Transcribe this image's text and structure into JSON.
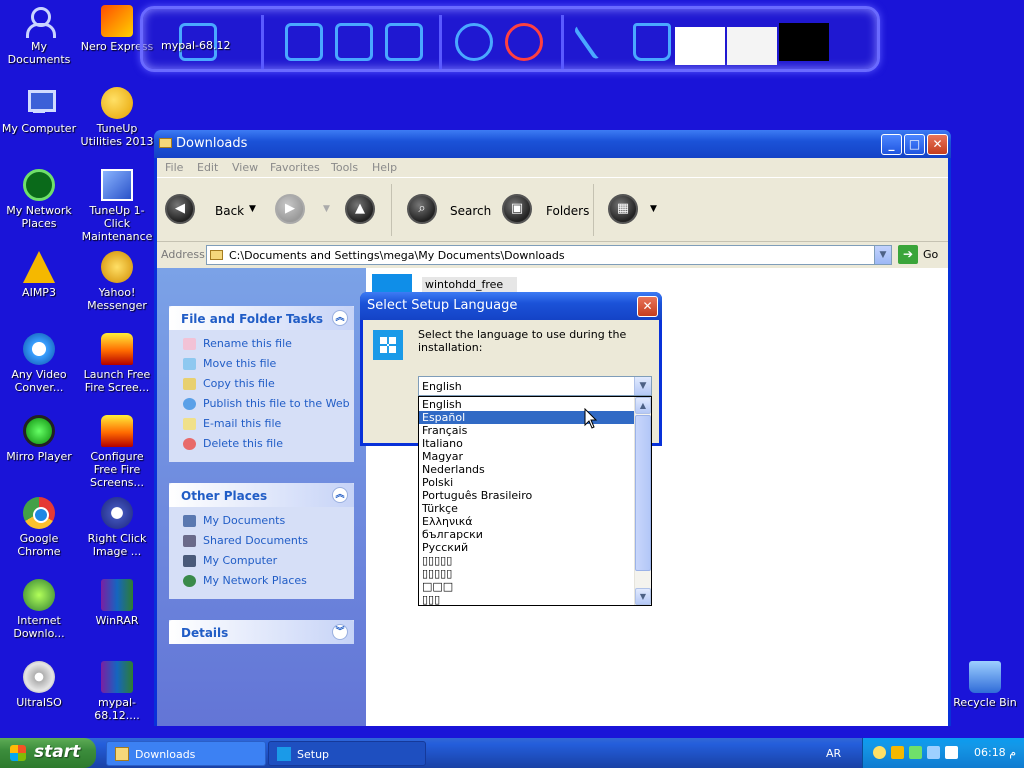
{
  "desktop_icons": [
    {
      "label": "My Documents",
      "icon": "my-documents-icon"
    },
    {
      "label": "Nero Express",
      "icon": "nero-express-icon"
    },
    {
      "label": "My Computer",
      "icon": "my-computer-icon"
    },
    {
      "label": "TuneUp Utilities 2013",
      "icon": "tuneup-utilities-icon"
    },
    {
      "label": "My Network Places",
      "icon": "my-network-places-icon"
    },
    {
      "label": "TuneUp 1-Click Maintenance",
      "icon": "tuneup-1-click-icon"
    },
    {
      "label": "AIMP3",
      "icon": "aimp3-icon"
    },
    {
      "label": "Yahoo! Messenger",
      "icon": "yahoo-messenger-icon"
    },
    {
      "label": "Any Video Conver...",
      "icon": "any-video-converter-icon"
    },
    {
      "label": "Launch Free Fire Scree...",
      "icon": "launch-free-fire-screensaver-icon"
    },
    {
      "label": "Mirro Player",
      "icon": "mirro-player-icon"
    },
    {
      "label": "Configure Free Fire Screens...",
      "icon": "configure-free-fire-screensaver-icon"
    },
    {
      "label": "Google Chrome",
      "icon": "google-chrome-icon"
    },
    {
      "label": "Right Click Image ...",
      "icon": "right-click-image-icon"
    },
    {
      "label": "Internet Downlo...",
      "icon": "internet-download-manager-icon"
    },
    {
      "label": "WinRAR",
      "icon": "winrar-icon"
    },
    {
      "label": "UltraISO",
      "icon": "ultraiso-icon"
    },
    {
      "label": "mypal-68.12....",
      "icon": "mypal-icon"
    },
    {
      "label": "Recycle Bin",
      "icon": "recycle-bin-icon"
    }
  ],
  "dock": {
    "label": "mypal-68.12",
    "items": [
      "computer-settings-icon",
      "user-folder-icon",
      "picture-folder-icon",
      "music-folder-icon",
      "internet-explorer-icon",
      "media-player-icon",
      "tools-icon",
      "recycle-bin-icon"
    ]
  },
  "explorer": {
    "title": "Downloads",
    "menu": [
      "File",
      "Edit",
      "View",
      "Favorites",
      "Tools",
      "Help"
    ],
    "toolbar": {
      "back": "Back",
      "search": "Search",
      "folders": "Folders"
    },
    "address_label": "Address",
    "address": "C:\\Documents and Settings\\mega\\My Documents\\Downloads",
    "go": "Go",
    "file_tasks": {
      "title": "File and Folder Tasks",
      "items": [
        "Rename this file",
        "Move this file",
        "Copy this file",
        "Publish this file to the Web",
        "E-mail this file",
        "Delete this file"
      ]
    },
    "other_places": {
      "title": "Other Places",
      "items": [
        "My Documents",
        "Shared Documents",
        "My Computer",
        "My Network Places"
      ]
    },
    "details": {
      "title": "Details"
    },
    "file": {
      "name": "wintohdd_free"
    }
  },
  "setup_dialog": {
    "title": "Select Setup Language",
    "prompt": "Select the language to use during the installation:",
    "selected": "English",
    "options": [
      "English",
      "Español",
      "Français",
      "Italiano",
      "Magyar",
      "Nederlands",
      "Polski",
      "Português Brasileiro",
      "Türkçe",
      "Ελληνικά",
      "български",
      "Русский",
      "▯▯▯▯▯",
      "▯▯▯▯▯",
      "□□□",
      "▯▯▯"
    ],
    "highlighted_index": 1
  },
  "taskbar": {
    "start": "start",
    "tasks": [
      "Downloads",
      "Setup"
    ],
    "language": "AR",
    "clock": "06:18 م"
  },
  "colors": {
    "desktop": "#1a14d8",
    "xp_blue": "#0831d9",
    "selection": "#316ac5",
    "link": "#215dc6"
  }
}
